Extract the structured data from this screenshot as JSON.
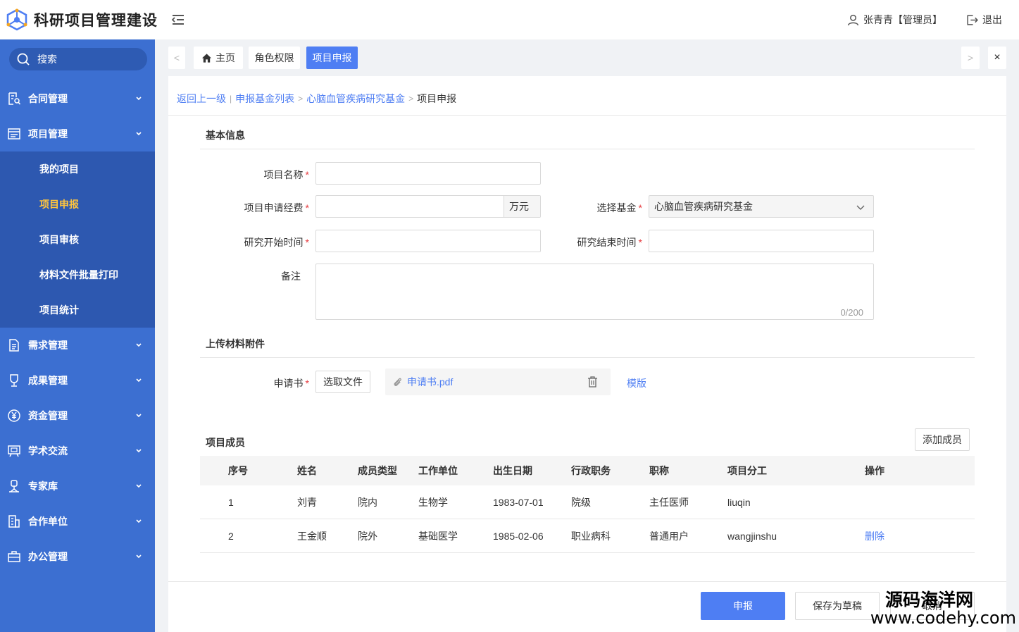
{
  "app": {
    "title": "科研项目管理建设"
  },
  "header": {
    "user_label": "张青青【管理员】",
    "logout_label": "退出"
  },
  "sidebar": {
    "search_label": "搜索",
    "menu": [
      {
        "label": "合同管理",
        "icon": "contract-icon"
      },
      {
        "label": "项目管理",
        "icon": "project-icon",
        "expanded": true,
        "children": [
          {
            "label": "我的项目"
          },
          {
            "label": "项目申报",
            "active": true
          },
          {
            "label": "项目审核"
          },
          {
            "label": "材料文件批量打印"
          },
          {
            "label": "项目统计"
          }
        ]
      },
      {
        "label": "需求管理",
        "icon": "document-icon"
      },
      {
        "label": "成果管理",
        "icon": "trophy-icon"
      },
      {
        "label": "资金管理",
        "icon": "yen-icon"
      },
      {
        "label": "学术交流",
        "icon": "presentation-icon"
      },
      {
        "label": "专家库",
        "icon": "expert-icon"
      },
      {
        "label": "合作单位",
        "icon": "building-icon"
      },
      {
        "label": "办公管理",
        "icon": "briefcase-icon"
      }
    ],
    "colors": {
      "bg": "#3c6fd1",
      "submenu_bg": "#2d58b0",
      "active": "#ffc53d"
    }
  },
  "tabs": {
    "prev": "<",
    "next": ">",
    "close": "×",
    "items": [
      {
        "label": "主页",
        "icon": "home-icon"
      },
      {
        "label": "角色权限"
      },
      {
        "label": "项目申报",
        "active": true
      }
    ]
  },
  "breadcrumb": {
    "back": "返回上一级",
    "divider": "|",
    "items": [
      "申报基金列表",
      "心脑血管疾病研究基金"
    ],
    "sep": ">",
    "current": "项目申报"
  },
  "form": {
    "section_basic": "基本信息",
    "project_name": {
      "label": "项目名称",
      "value": ""
    },
    "funding": {
      "label": "项目申请经费",
      "value": "",
      "suffix": "万元"
    },
    "fund_select": {
      "label": "选择基金",
      "value": "心脑血管疾病研究基金"
    },
    "start_date": {
      "label": "研究开始时间",
      "value": ""
    },
    "end_date": {
      "label": "研究结束时间",
      "value": ""
    },
    "remark": {
      "label": "备注",
      "value": "",
      "counter": "0/200"
    },
    "section_upload": "上传材料附件",
    "application": {
      "label": "申请书",
      "choose_btn": "选取文件",
      "file_name": "申请书.pdf",
      "template_link": "模版"
    },
    "required_mark": "*"
  },
  "members": {
    "title": "项目成员",
    "add_btn": "添加成员",
    "columns": [
      "序号",
      "姓名",
      "成员类型",
      "工作单位",
      "出生日期",
      "行政职务",
      "职称",
      "项目分工",
      "操作"
    ],
    "rows": [
      {
        "no": "1",
        "name": "刘青",
        "type": "院内",
        "unit": "生物学",
        "birth": "1983-07-01",
        "position": "院级",
        "title": "主任医师",
        "role": "liuqin",
        "action": ""
      },
      {
        "no": "2",
        "name": "王金顺",
        "type": "院外",
        "unit": "基础医学",
        "birth": "1985-02-06",
        "position": "职业病科",
        "title": "普通用户",
        "role": "wangjinshu",
        "action": "删除"
      }
    ]
  },
  "footer": {
    "submit": "申报",
    "save_draft": "保存为草稿",
    "cancel": "取消"
  },
  "watermark": {
    "line1": "源码海洋网",
    "line2": "www.codehy.com"
  },
  "theme": {
    "primary": "#4e7ef3",
    "required": "#e6393d"
  }
}
